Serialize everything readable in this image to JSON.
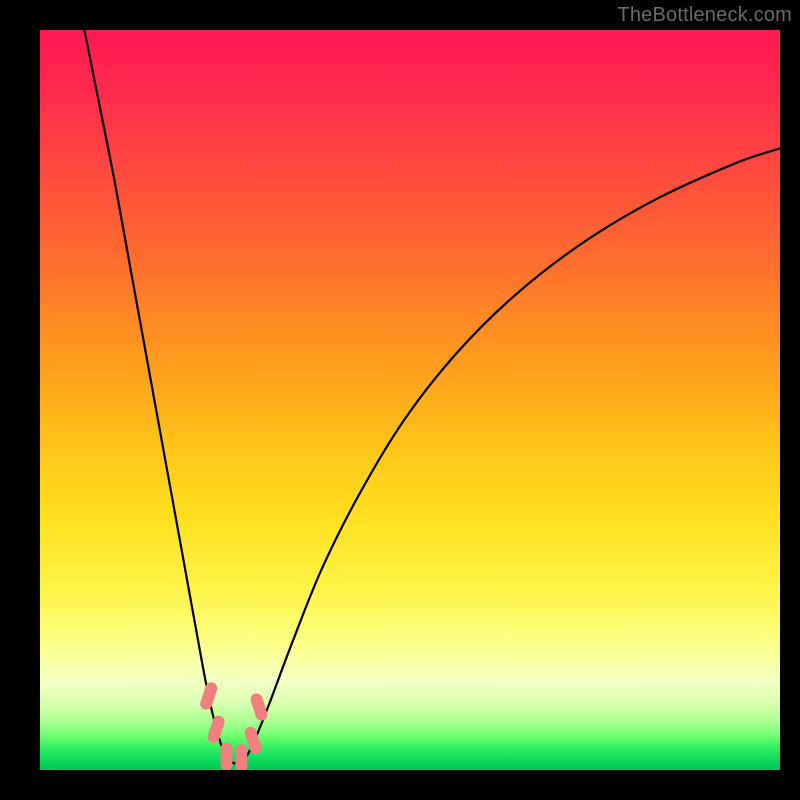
{
  "attribution": "TheBottleneck.com",
  "colors": {
    "background": "#000000",
    "curve_stroke": "#000000",
    "marker_fill": "#f08080",
    "gradient_top": "#ff1a52",
    "gradient_bottom": "#04c854"
  },
  "chart_data": {
    "type": "line",
    "title": "",
    "xlabel": "",
    "ylabel": "",
    "xlim": [
      0,
      100
    ],
    "ylim": [
      0,
      100
    ],
    "grid": false,
    "note": "Curve coordinates are estimated from pixels; x and y in percent of plot area (origin bottom-left). V-shaped bottleneck curve with minimum near x≈26.",
    "series": [
      {
        "name": "bottleneck-curve",
        "x": [
          6,
          8,
          10,
          12,
          14,
          16,
          18,
          20,
          22,
          23,
          24,
          25,
          26,
          27,
          28,
          29,
          31,
          34,
          38,
          43,
          49,
          56,
          64,
          73,
          83,
          94,
          100
        ],
        "y": [
          100,
          90,
          80,
          69,
          58,
          47,
          36,
          25,
          14,
          9,
          5,
          2,
          1,
          1,
          2,
          4,
          9,
          17,
          27,
          37,
          47,
          56,
          64,
          71,
          77,
          82,
          84
        ]
      }
    ],
    "markers": {
      "name": "optimum-markers",
      "x": [
        22.8,
        23.8,
        25.2,
        27.2,
        28.8,
        29.6
      ],
      "y": [
        10.0,
        5.5,
        1.8,
        1.6,
        4.0,
        8.5
      ]
    }
  }
}
